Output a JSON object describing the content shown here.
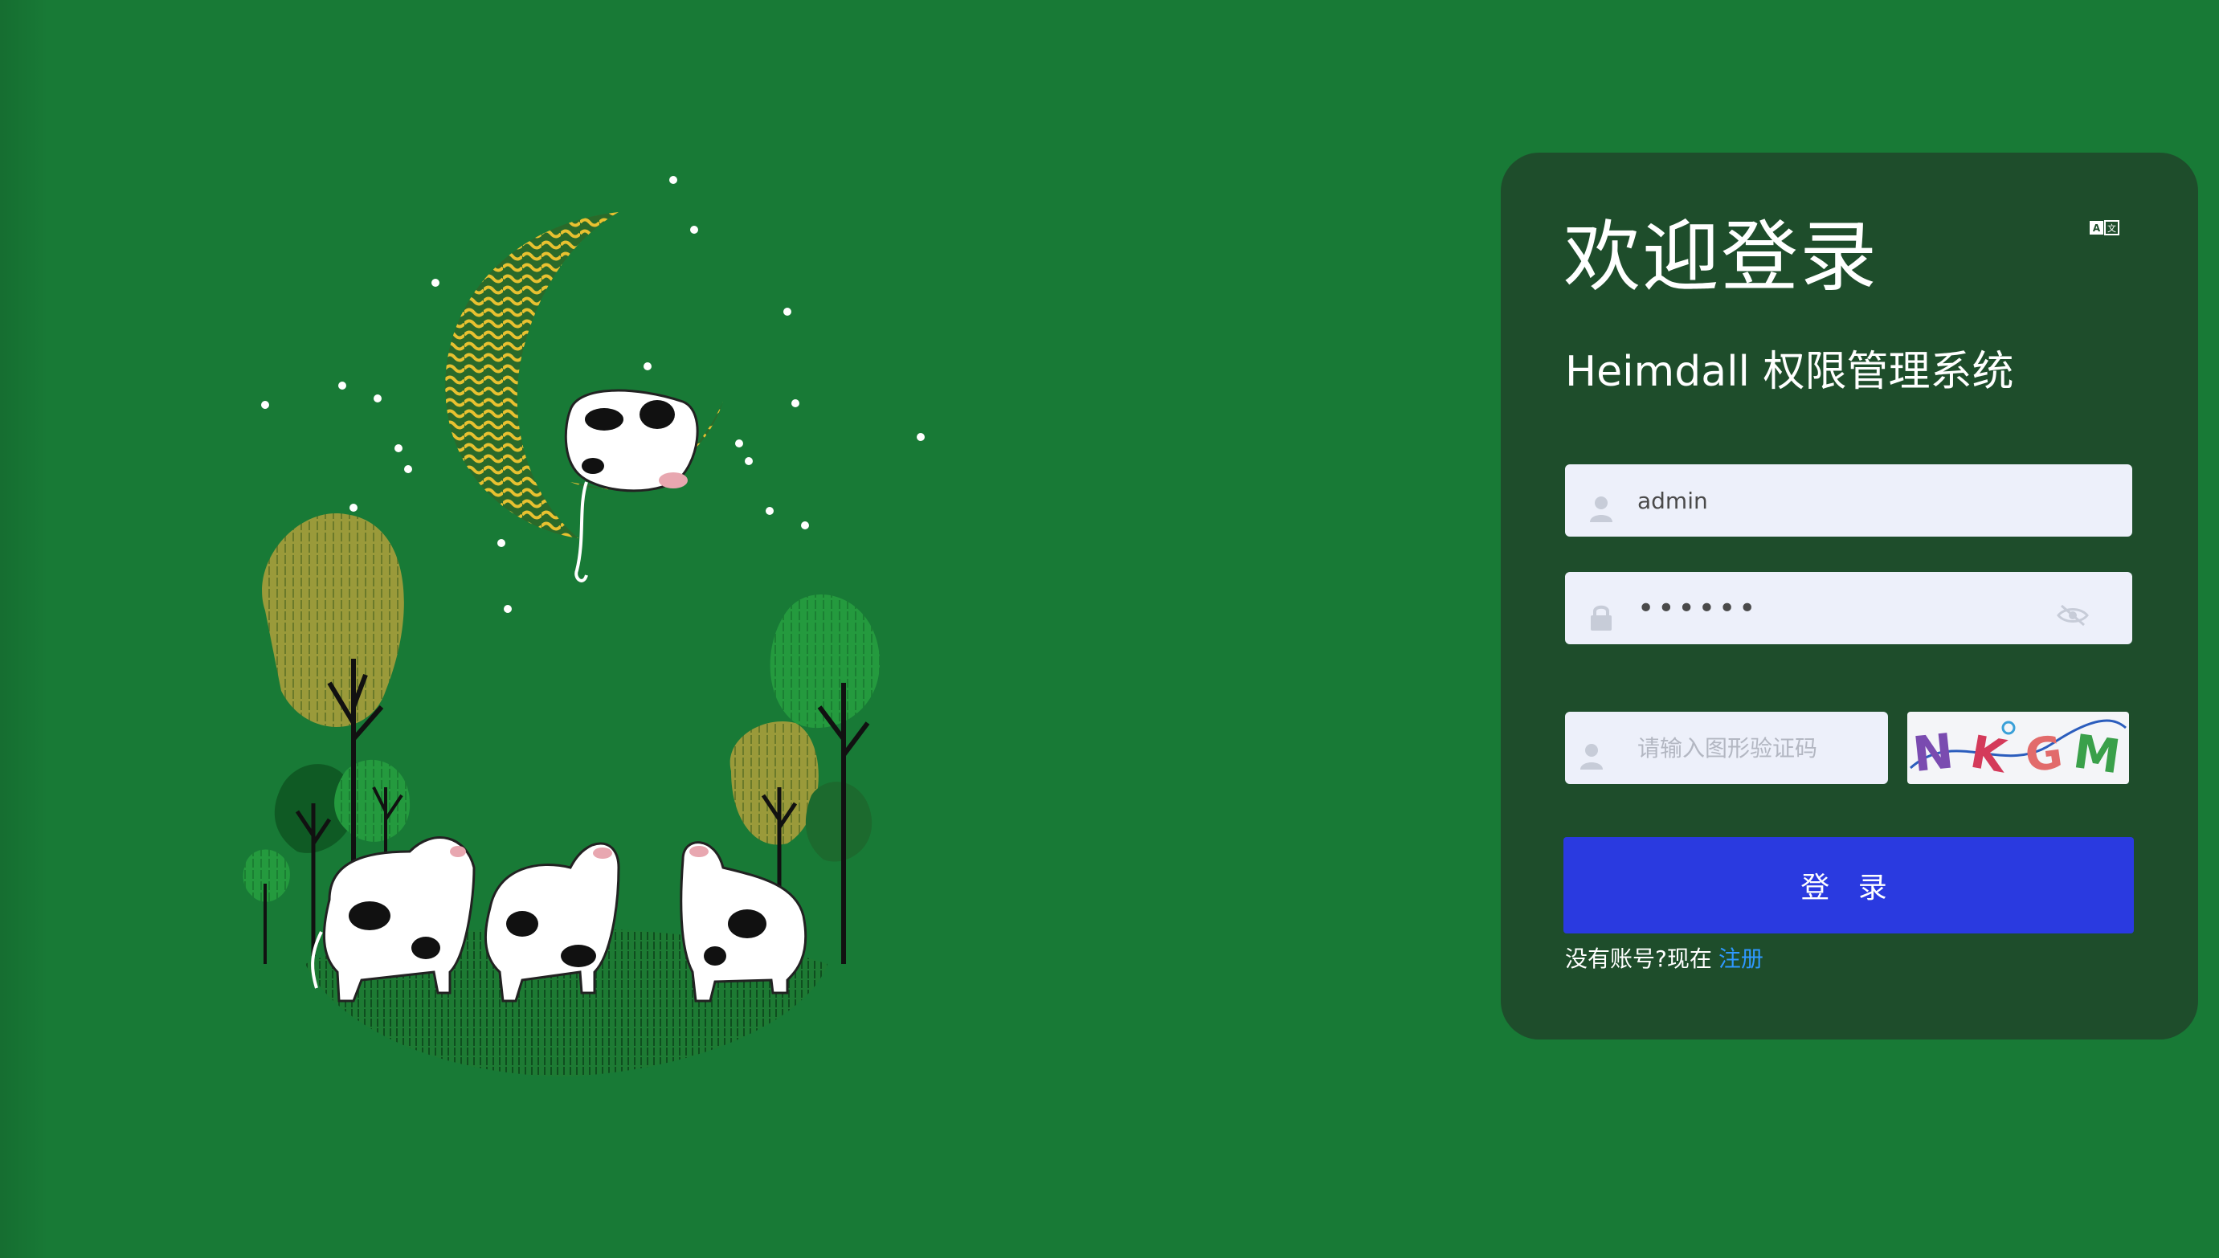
{
  "login": {
    "title": "欢迎登录",
    "subtitle": "Heimdall 权限管理系统",
    "language_toggle_icon": "translate-icon",
    "username": {
      "value": "admin",
      "icon": "user-icon"
    },
    "password": {
      "value": "••••••",
      "icon": "lock-icon",
      "toggle_icon": "eye-off-icon"
    },
    "captcha": {
      "placeholder": "请输入图形验证码",
      "icon": "user-icon",
      "image_text": "NKGM"
    },
    "submit_label": "登 录",
    "register_prompt": "没有账号?现在",
    "register_link": "注册"
  },
  "colors": {
    "background": "#187a36",
    "panel": "#1e4d2b",
    "input_bg": "#edf0fa",
    "button": "#2a3ae0",
    "link": "#2f98ff"
  }
}
